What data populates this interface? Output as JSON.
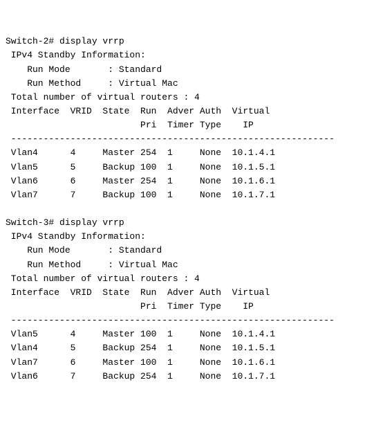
{
  "blocks": [
    {
      "prompt": "Switch-2#",
      "command": "display vrrp",
      "title": "IPv4 Standby Information:",
      "run_mode_label": "Run Mode",
      "run_mode_value": "Standard",
      "run_method_label": "Run Method",
      "run_method_value": "Virtual Mac",
      "total_label": "Total number of virtual routers :",
      "total_value": "4",
      "cols": {
        "interface": "Interface",
        "vrid": "VRID",
        "state": "State",
        "run": "Run",
        "adver": "Adver",
        "auth": "Auth",
        "virtual": "Virtual",
        "pri": "Pri",
        "timer": "Timer",
        "type": "Type",
        "ip": "IP"
      },
      "rows": [
        {
          "interface": "Vlan4",
          "vrid": "4",
          "state": "Master",
          "pri": "254",
          "timer": "1",
          "auth": "None",
          "ip": "10.1.4.1"
        },
        {
          "interface": "Vlan5",
          "vrid": "5",
          "state": "Backup",
          "pri": "100",
          "timer": "1",
          "auth": "None",
          "ip": "10.1.5.1"
        },
        {
          "interface": "Vlan6",
          "vrid": "6",
          "state": "Master",
          "pri": "254",
          "timer": "1",
          "auth": "None",
          "ip": "10.1.6.1"
        },
        {
          "interface": "Vlan7",
          "vrid": "7",
          "state": "Backup",
          "pri": "100",
          "timer": "1",
          "auth": "None",
          "ip": "10.1.7.1"
        }
      ]
    },
    {
      "prompt": "Switch-3#",
      "command": "display vrrp",
      "title": "IPv4 Standby Information:",
      "run_mode_label": "Run Mode",
      "run_mode_value": "Standard",
      "run_method_label": "Run Method",
      "run_method_value": "Virtual Mac",
      "total_label": "Total number of virtual routers :",
      "total_value": "4",
      "cols": {
        "interface": "Interface",
        "vrid": "VRID",
        "state": "State",
        "run": "Run",
        "adver": "Adver",
        "auth": "Auth",
        "virtual": "Virtual",
        "pri": "Pri",
        "timer": "Timer",
        "type": "Type",
        "ip": "IP"
      },
      "rows": [
        {
          "interface": "Vlan5",
          "vrid": "4",
          "state": "Master",
          "pri": "100",
          "timer": "1",
          "auth": "None",
          "ip": "10.1.4.1"
        },
        {
          "interface": "Vlan4",
          "vrid": "5",
          "state": "Backup",
          "pri": "254",
          "timer": "1",
          "auth": "None",
          "ip": "10.1.5.1"
        },
        {
          "interface": "Vlan7",
          "vrid": "6",
          "state": "Master",
          "pri": "100",
          "timer": "1",
          "auth": "None",
          "ip": "10.1.6.1"
        },
        {
          "interface": "Vlan6",
          "vrid": "7",
          "state": "Backup",
          "pri": "254",
          "timer": "1",
          "auth": "None",
          "ip": "10.1.7.1"
        }
      ]
    }
  ]
}
